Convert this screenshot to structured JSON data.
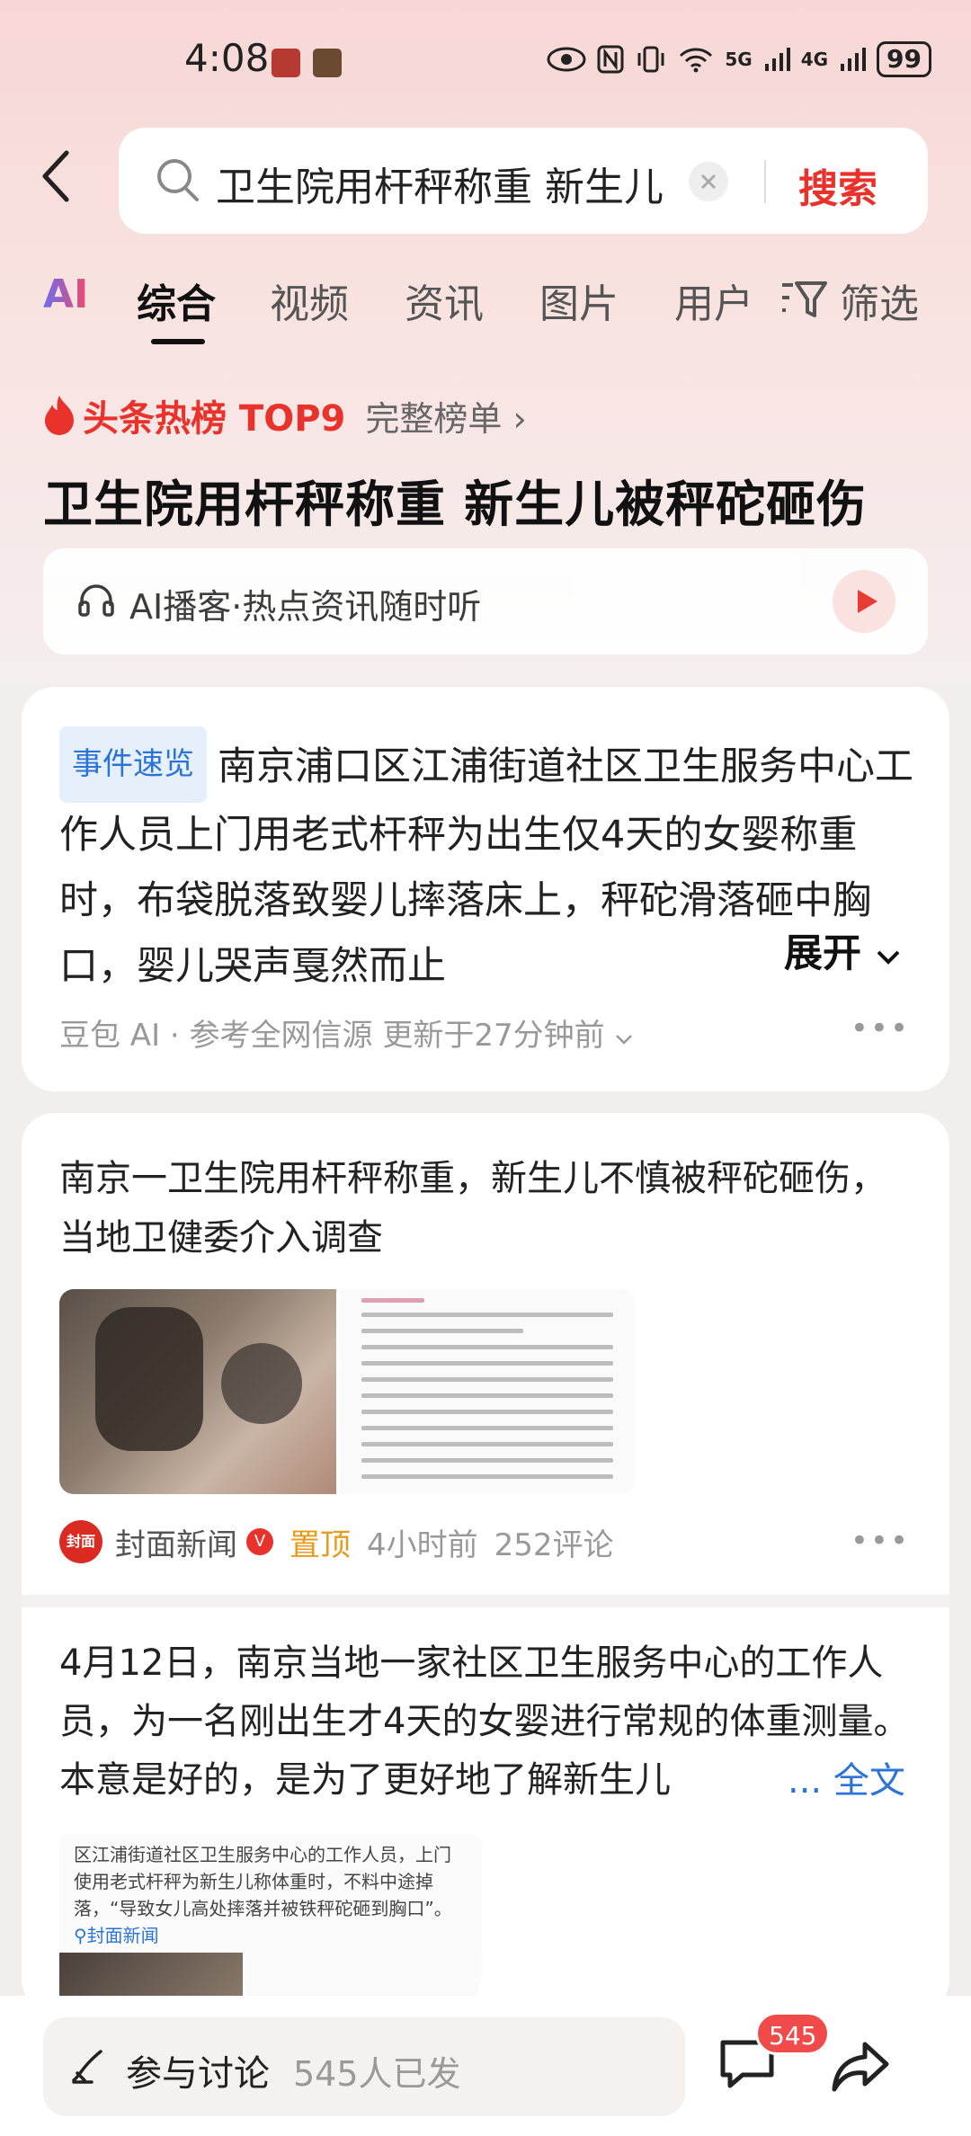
{
  "status_bar": {
    "time": "4:08",
    "network": "5G",
    "network2": "4G",
    "battery": "99"
  },
  "search": {
    "query": "卫生院用杆秤称重 新生儿",
    "button_label": "搜索"
  },
  "tabs": {
    "ai": "AI",
    "items": [
      "综合",
      "视频",
      "资讯",
      "图片",
      "用户"
    ],
    "filter_label": "筛选"
  },
  "hot": {
    "label": "头条热榜 TOP9",
    "more": "完整榜单 ›",
    "headline": "卫生院用杆秤称重 新生儿被秤砣砸伤"
  },
  "podcast": {
    "label": "AI播客·热点资讯随时听"
  },
  "summary_card": {
    "tag": "事件速览",
    "text": "南京浦口区江浦街道社区卫生服务中心工作人员上门用老式杆秤为出生仅4天的女婴称重时，布袋脱落致婴儿摔落床上，秤砣滑落砸中胸口，婴儿哭声戛然而止",
    "expand_label": "展开",
    "meta": "豆包 AI · 参考全网信源 更新于27分钟前",
    "more": "•••"
  },
  "news_card": {
    "title": "南京一卫生院用杆秤称重，新生儿不慎被秤砣砸伤，当地卫健委介入调查",
    "source_logo_text": "封面",
    "source": "封面新闻",
    "verified": "V",
    "pinned": "置顶",
    "time_ago": "4小时前",
    "comments": "252评论",
    "more": "•••"
  },
  "article": {
    "text": "4月12日，南京当地一家社区卫生服务中心的工作人员，为一名刚出生才4天的女婴进行常规的体重测量。本意是好的，是为了更好地了解新生儿",
    "full_text_label": "... 全文",
    "quote": "区江浦街道社区卫生服务中心的工作人员，上门使用老式杆秤为新生儿称体重时，不料中途掉落，“导致女儿高处摔落并被铁秤砣砸到胸口”。",
    "quote_link": "封面新闻"
  },
  "bottom": {
    "discuss_label": "参与讨论",
    "discuss_count": "545人已发",
    "comment_badge": "545"
  },
  "colors": {
    "accent": "#e8322b",
    "link": "#2b74d6",
    "pinned": "#e89a1c"
  }
}
